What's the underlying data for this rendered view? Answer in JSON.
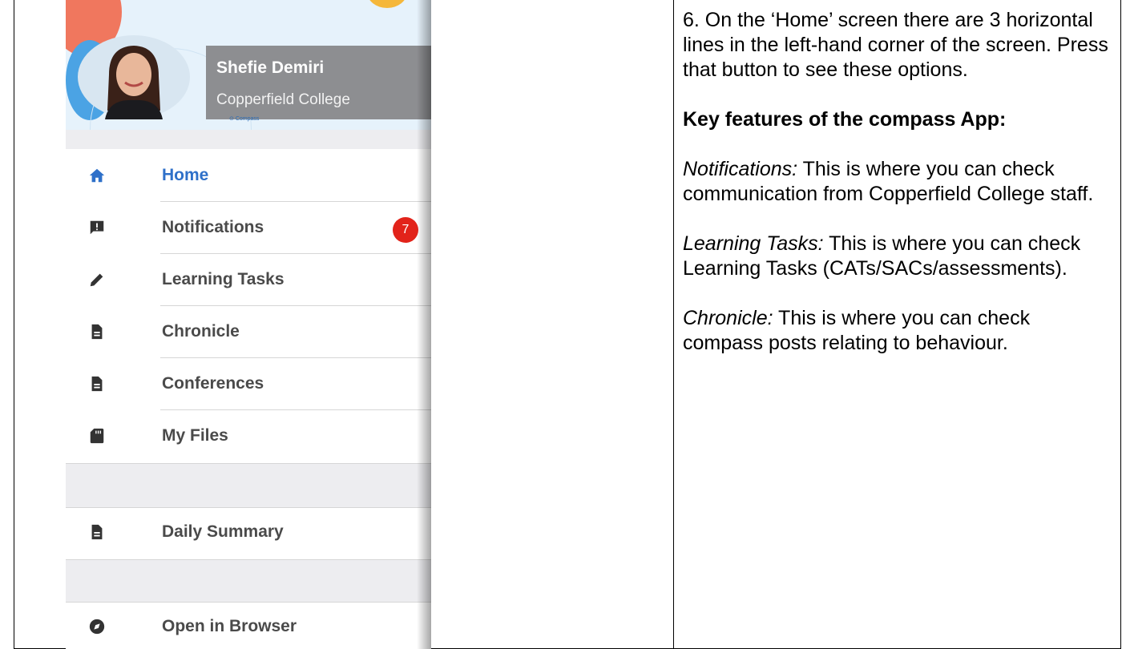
{
  "profile": {
    "name": "Shefie Demiri",
    "school": "Copperfield College",
    "logo_text": "Compass"
  },
  "menu": {
    "items": [
      {
        "label": "Home",
        "icon": "home-icon",
        "active": true
      },
      {
        "label": "Notifications",
        "icon": "chat-alert-icon",
        "badge": "7"
      },
      {
        "label": "Learning Tasks",
        "icon": "pencil-icon"
      },
      {
        "label": "Chronicle",
        "icon": "document-icon"
      },
      {
        "label": "Conferences",
        "icon": "document-icon"
      },
      {
        "label": "My Files",
        "icon": "sd-card-icon"
      }
    ],
    "secondary": [
      {
        "label": "Daily Summary",
        "icon": "document-icon"
      },
      {
        "label": "Open in Browser",
        "icon": "compass-globe-icon"
      }
    ]
  },
  "colors": {
    "active": "#2e70c9",
    "badge": "#e2231a",
    "name_box": "#8d8e91"
  },
  "instructions": {
    "step": "6. On the ‘Home’ screen there are 3 horizontal lines in the left-hand corner of the screen. Press that button to see these options.",
    "heading": "Key features of the compass App:",
    "features": [
      {
        "term": "Notifications:",
        "desc": " This is where you can check communication from Copperfield College staff."
      },
      {
        "term": "Learning Tasks:",
        "desc": " This is where you can check Learning Tasks (CATs/SACs/assessments)."
      },
      {
        "term": "Chronicle:",
        "desc": " This is where you can check compass posts relating to behaviour."
      }
    ]
  }
}
